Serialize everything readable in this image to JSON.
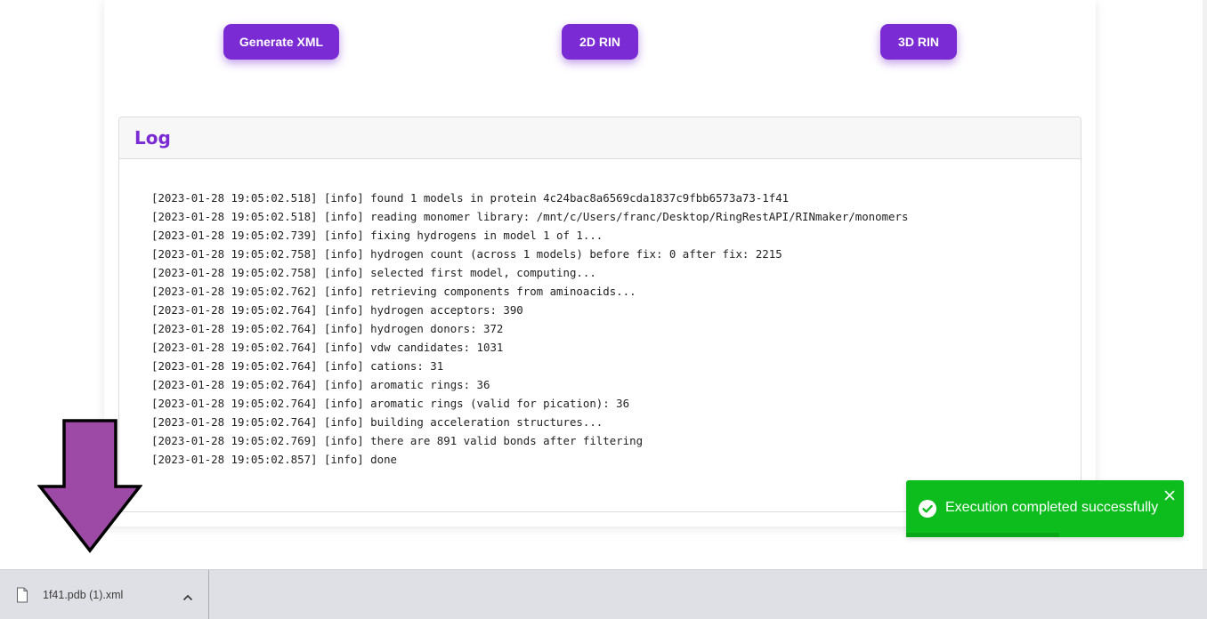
{
  "buttons": {
    "generate_xml": "Generate XML",
    "rin_2d": "2D RIN",
    "rin_3d": "3D RIN"
  },
  "log": {
    "title": "Log",
    "lines": [
      "[2023-01-28 19:05:02.518] [info] found 1 models in protein 4c24bac8a6569cda1837c9fbb6573a73-1f41",
      "[2023-01-28 19:05:02.518] [info] reading monomer library: /mnt/c/Users/franc/Desktop/RingRestAPI/RINmaker/monomers",
      "[2023-01-28 19:05:02.739] [info] fixing hydrogens in model 1 of 1...",
      "[2023-01-28 19:05:02.758] [info] hydrogen count (across 1 models) before fix: 0 after fix: 2215",
      "[2023-01-28 19:05:02.758] [info] selected first model, computing...",
      "[2023-01-28 19:05:02.762] [info] retrieving components from aminoacids...",
      "[2023-01-28 19:05:02.764] [info] hydrogen acceptors: 390",
      "[2023-01-28 19:05:02.764] [info] hydrogen donors: 372",
      "[2023-01-28 19:05:02.764] [info] vdw candidates: 1031",
      "[2023-01-28 19:05:02.764] [info] cations: 31",
      "[2023-01-28 19:05:02.764] [info] aromatic rings: 36",
      "[2023-01-28 19:05:02.764] [info] aromatic rings (valid for pication): 36",
      "[2023-01-28 19:05:02.764] [info] building acceleration structures...",
      "[2023-01-28 19:05:02.769] [info] there are 891 valid bonds after filtering",
      "[2023-01-28 19:05:02.857] [info] done"
    ]
  },
  "toast": {
    "message": "Execution completed successfully",
    "icon": "check-circle-icon",
    "close_icon": "close-icon",
    "progress_remaining": 0.55
  },
  "download_bar": {
    "file_name": "1f41.pdb (1).xml",
    "file_icon": "file-icon",
    "menu_icon": "chevron-up-icon"
  },
  "annotation": {
    "icon": "down-arrow-icon"
  },
  "colors": {
    "accent": "#7b2bd3",
    "toast_bg": "#0dbd1e",
    "arrow_fill": "#9c4aa6"
  }
}
